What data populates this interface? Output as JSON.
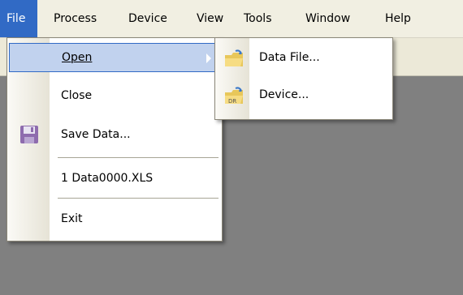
{
  "menubar": {
    "items": [
      {
        "label": "File",
        "active": true
      },
      {
        "label": "Process"
      },
      {
        "label": "Device"
      },
      {
        "label": "View"
      },
      {
        "label": "Tools"
      },
      {
        "label": "Window"
      },
      {
        "label": "Help"
      }
    ]
  },
  "file_menu": {
    "open": {
      "label": "Open",
      "icon": "none",
      "has_submenu": true
    },
    "close": {
      "label": "Close"
    },
    "save": {
      "label": "Save Data...",
      "icon": "floppy-disk-icon"
    },
    "recent": {
      "label": "1 Data0000.XLS"
    },
    "exit": {
      "label": "Exit"
    }
  },
  "open_submenu": {
    "data_file": {
      "label": "Data File...",
      "icon": "open-folder-icon"
    },
    "device": {
      "label": "Device...",
      "icon": "device-folder-icon"
    }
  },
  "colors": {
    "menu_highlight": "#316ac5",
    "item_highlight": "#c1d2ee",
    "menubar_bg": "#f1efe2",
    "workspace_bg": "#808080"
  }
}
